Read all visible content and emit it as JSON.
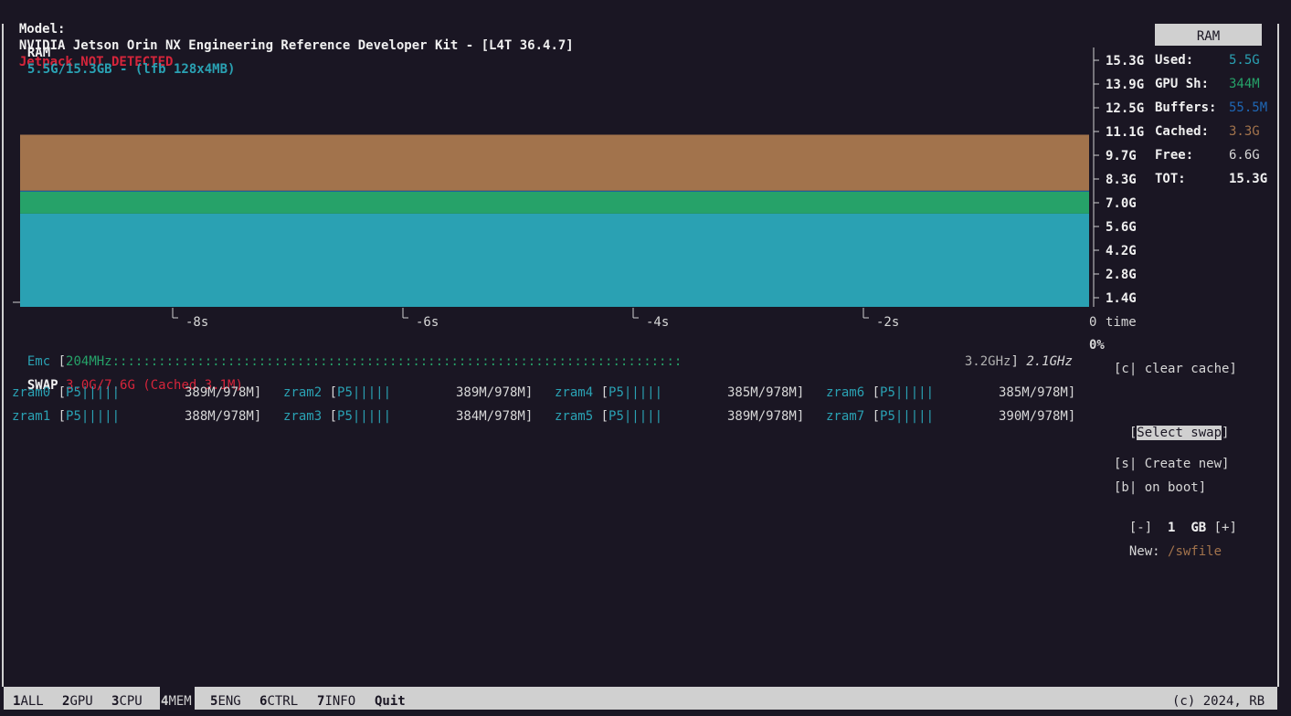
{
  "header": {
    "model_label": "Model:",
    "model_value": "NVIDIA Jetson Orin NX Engineering Reference Developer Kit - [L4T 36.4.7]",
    "jetpack_status": "Jetpack NOT DETECTED"
  },
  "ram": {
    "title": "RAM",
    "usage": "5.5G/15.3GB - (lfb 128x4MB)",
    "panel_label": "RAM",
    "y_ticks": [
      "15.3G",
      "13.9G",
      "12.5G",
      "11.1G",
      "9.7G",
      "8.3G",
      "7.0G",
      "5.6G",
      "4.2G",
      "2.8G",
      "1.4G"
    ],
    "x_ticks": [
      "-8s",
      "-6s",
      "-4s",
      "-2s",
      "0"
    ],
    "x_unit": "time",
    "stats": [
      {
        "label": "Used:",
        "value": "5.5G",
        "color": "#2aa1b3"
      },
      {
        "label": "GPU Sh:",
        "value": "344M",
        "color": "#26a269"
      },
      {
        "label": "Buffers:",
        "value": "55.5M",
        "color": "#1f67b5"
      },
      {
        "label": "Cached:",
        "value": "3.3G",
        "color": "#a2734c"
      },
      {
        "label": "Free:",
        "value": "6.6G",
        "color": "#d7d7d7"
      },
      {
        "label": "TOT:",
        "value": "15.3G",
        "color": "#f0f0f0"
      }
    ]
  },
  "chart_data": {
    "type": "area",
    "x": [
      -9.3,
      0
    ],
    "xlabel": "time",
    "ylim": [
      0,
      15.3
    ],
    "series": [
      {
        "name": "Used",
        "values": [
          5.5,
          5.5
        ],
        "color": "#2aa1b3"
      },
      {
        "name": "GPU Sh",
        "values": [
          1.3,
          1.3
        ],
        "color": "#26a269"
      },
      {
        "name": "Buffers",
        "values": [
          0.0555,
          0.0555
        ],
        "color": "#1f67b5"
      },
      {
        "name": "Cached",
        "values": [
          3.3,
          3.3
        ],
        "color": "#a2734c"
      }
    ]
  },
  "emc": {
    "label": "Emc",
    "bracket_open": "[",
    "freq": "204MHz",
    "bar": "::::::::::::::::::::::::::::::::::::::::::::::::::::::::::::::::::::::::::",
    "max_freq": "3.2GHz",
    "bracket_close": "]",
    "cur_freq": "2.1GHz",
    "percent": "0%"
  },
  "swap": {
    "label": "SWAP",
    "usage": "3.0G/7.6G (Cached 3.1M)",
    "zram": [
      {
        "name": "zram0",
        "bar": "P5|||||",
        "value": "389M/978M"
      },
      {
        "name": "zram1",
        "bar": "P5|||||",
        "value": "388M/978M"
      },
      {
        "name": "zram2",
        "bar": "P5|||||",
        "value": "389M/978M"
      },
      {
        "name": "zram3",
        "bar": "P5|||||",
        "value": "384M/978M"
      },
      {
        "name": "zram4",
        "bar": "P5|||||",
        "value": "385M/978M"
      },
      {
        "name": "zram5",
        "bar": "P5|||||",
        "value": "389M/978M"
      },
      {
        "name": "zram6",
        "bar": "P5|||||",
        "value": "385M/978M"
      },
      {
        "name": "zram7",
        "bar": "P5|||||",
        "value": "390M/978M"
      }
    ]
  },
  "controls": {
    "clear_cache": "[c| clear cache]",
    "select_swap_open": "[",
    "select_swap": "Select swap",
    "select_swap_close": "]",
    "create_new": "[s| Create new]",
    "on_boot": "[b| on boot]",
    "size_minus": "[-]",
    "size_value": "1",
    "size_unit": "GB",
    "size_plus": "[+]",
    "new_label": "New:",
    "new_path": "/swfile"
  },
  "footer": {
    "tabs": [
      {
        "key": "1",
        "label": "ALL"
      },
      {
        "key": "2",
        "label": "GPU"
      },
      {
        "key": "3",
        "label": "CPU"
      },
      {
        "key": "4",
        "label": "MEM"
      },
      {
        "key": "5",
        "label": "ENG"
      },
      {
        "key": "6",
        "label": "CTRL"
      },
      {
        "key": "7",
        "label": "INFO"
      },
      {
        "key": "",
        "label": "Quit"
      }
    ],
    "copyright": "(c) 2024, RB"
  }
}
